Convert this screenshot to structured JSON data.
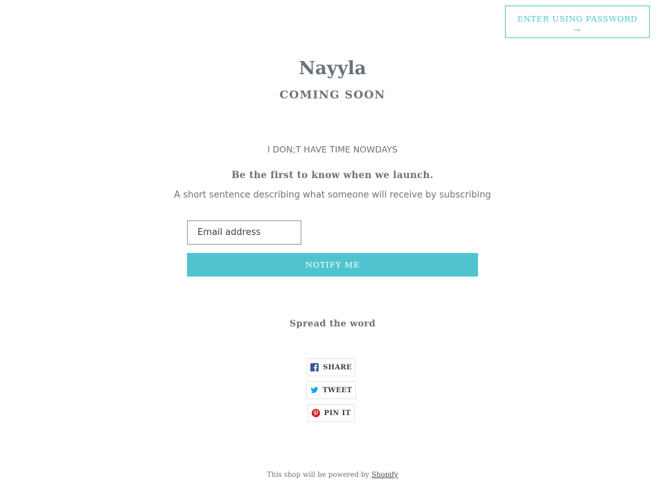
{
  "header": {
    "password_button_label": "Enter using password",
    "password_button_arrow": "→"
  },
  "hero": {
    "shop_name": "Nayyla",
    "status": "Coming Soon",
    "message": "I DON;T HAVE TIME NOWDAYS"
  },
  "newsletter": {
    "heading": "Be the first to know when we launch.",
    "subtext": "A short sentence describing what someone will receive by subscribing",
    "email_placeholder": "Email address",
    "email_value": "",
    "submit_label": "Notify me"
  },
  "social": {
    "heading": "Spread the word",
    "buttons": [
      {
        "label": "Share",
        "icon": "facebook-icon",
        "color": "#3b5998"
      },
      {
        "label": "Tweet",
        "icon": "twitter-icon",
        "color": "#00aced"
      },
      {
        "label": "Pin it",
        "icon": "pinterest-icon",
        "color": "#cb2027"
      }
    ]
  },
  "footer": {
    "text": "This shop will be powered by",
    "link_label": "Shopify"
  },
  "colors": {
    "accent": "#4fc4cf",
    "text": "#69727b",
    "border": "#949494"
  }
}
